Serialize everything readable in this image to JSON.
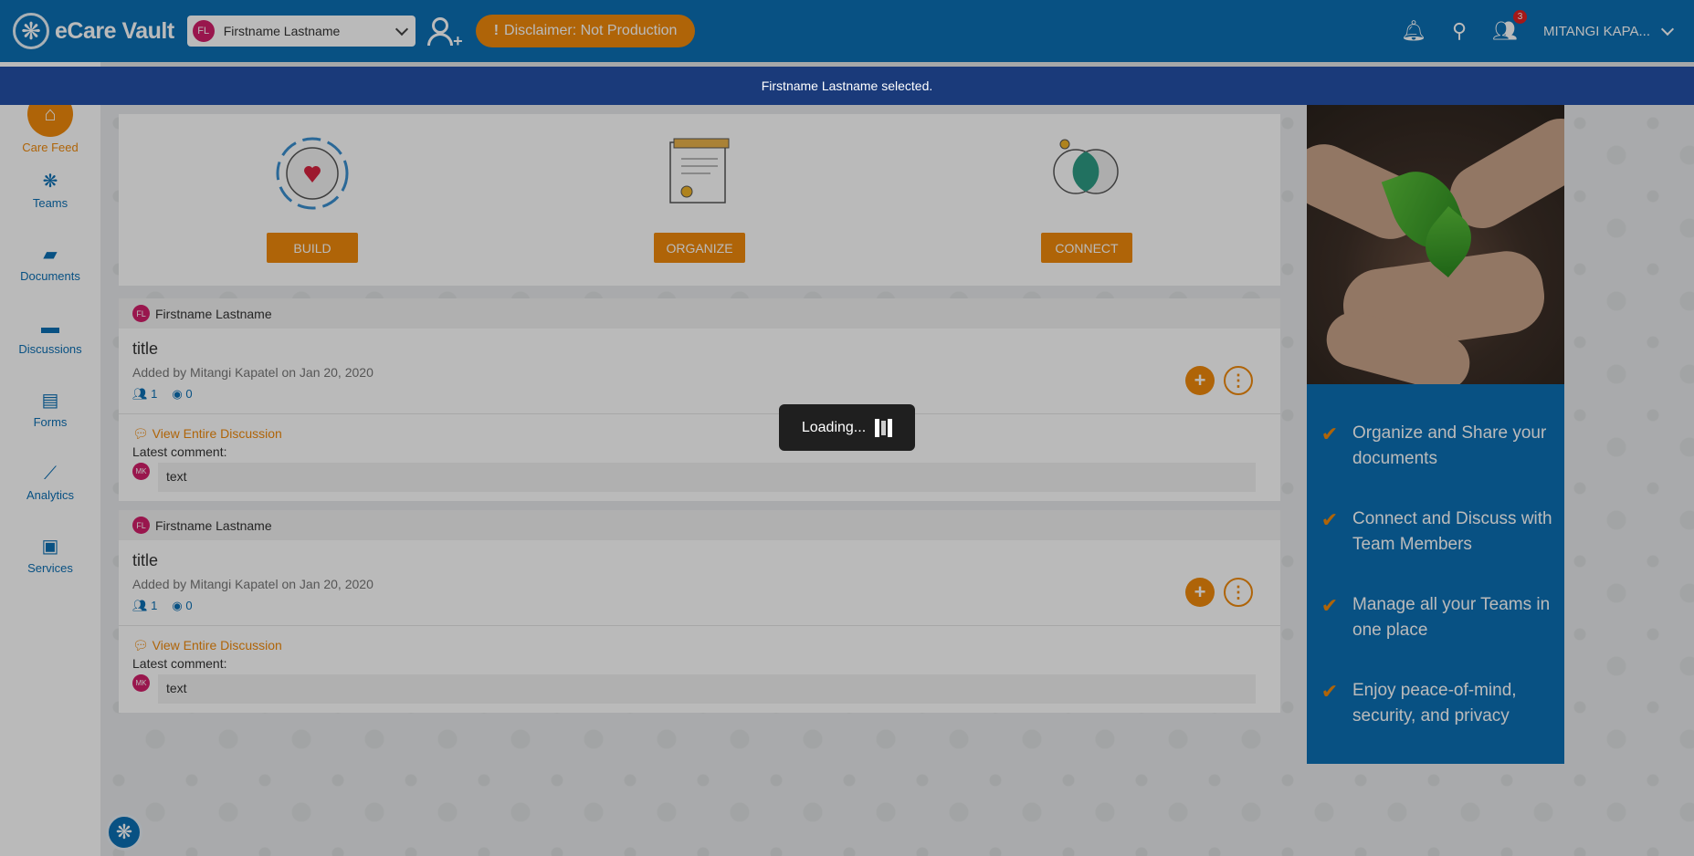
{
  "app": {
    "name": "eCare Vault"
  },
  "header": {
    "selected_person": {
      "initials": "FL",
      "name": "Firstname Lastname"
    },
    "disclaimer": "Disclaimer: Not Production",
    "notification_count": "3",
    "user_name": "MITANGI KAPA..."
  },
  "banner": {
    "message": "Firstname Lastname selected."
  },
  "sidebar": {
    "items": [
      {
        "label": "Care Feed",
        "icon": "home-icon"
      },
      {
        "label": "Teams",
        "icon": "teams-icon"
      },
      {
        "label": "Documents",
        "icon": "folder-icon"
      },
      {
        "label": "Discussions",
        "icon": "chat-icon"
      },
      {
        "label": "Forms",
        "icon": "form-icon"
      },
      {
        "label": "Analytics",
        "icon": "chart-icon"
      },
      {
        "label": "Services",
        "icon": "briefcase-icon"
      }
    ]
  },
  "hero": {
    "build": "BUILD",
    "organize": "ORGANIZE",
    "connect": "CONNECT"
  },
  "posts": [
    {
      "author_initials": "FL",
      "author": "Firstname Lastname",
      "title": "title",
      "meta": "Added by Mitangi Kapatel on Jan 20, 2020",
      "members": "1",
      "views": "0",
      "view_link": "View Entire Discussion",
      "latest_label": "Latest comment:",
      "commenter_initials": "MK",
      "comment": "text"
    },
    {
      "author_initials": "FL",
      "author": "Firstname Lastname",
      "title": "title",
      "meta": "Added by Mitangi Kapatel on Jan 20, 2020",
      "members": "1",
      "views": "0",
      "view_link": "View Entire Discussion",
      "latest_label": "Latest comment:",
      "commenter_initials": "MK",
      "comment": "text"
    }
  ],
  "promo": {
    "items": [
      "Organize and Share your documents",
      "Connect and Discuss with Team Members",
      "Manage all your Teams in one place",
      "Enjoy peace-of-mind, security, and privacy"
    ]
  },
  "loader": {
    "text": "Loading..."
  },
  "colors": {
    "primary": "#0c6fb4",
    "accent": "#f08a0c",
    "banner": "#1a3a7a"
  }
}
